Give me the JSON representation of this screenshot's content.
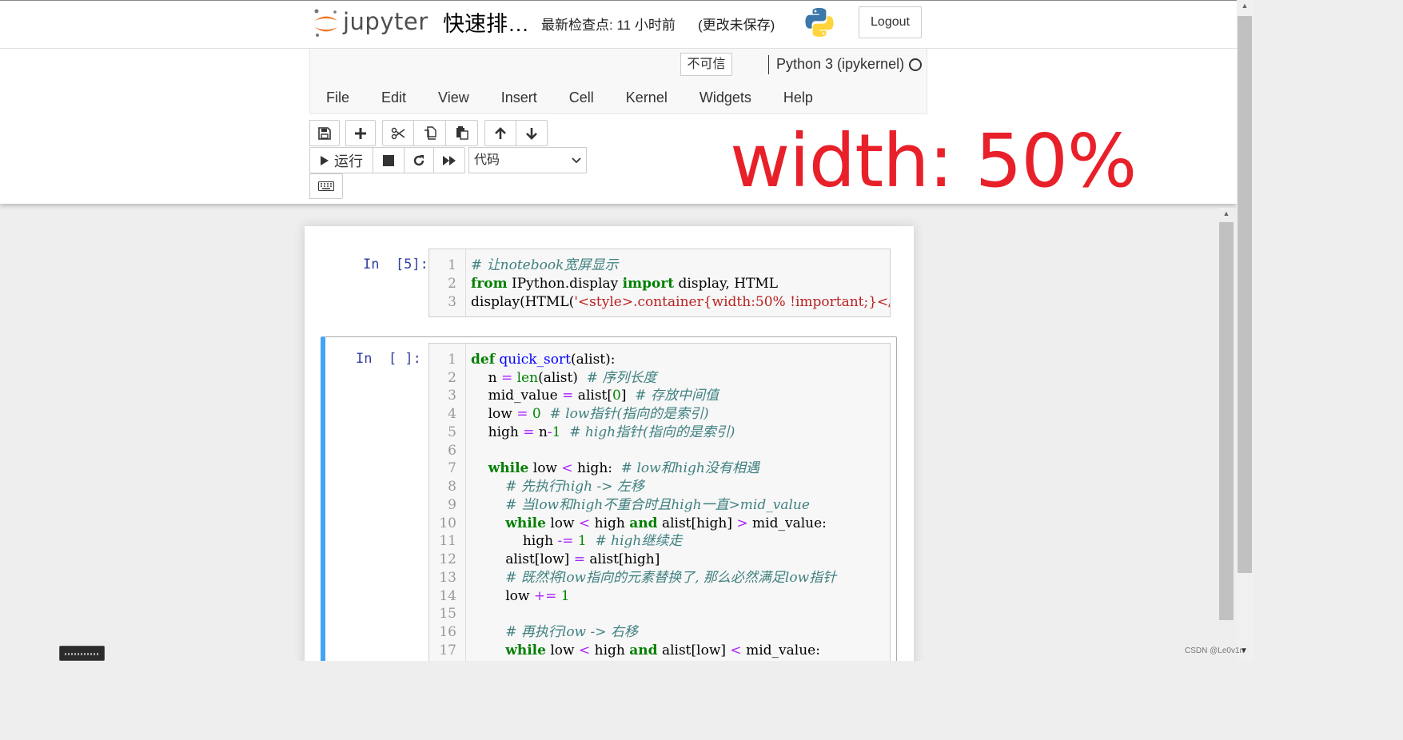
{
  "header": {
    "logo_text": "jupyter",
    "notebook_title": "快速排…",
    "checkpoint": "最新检查点: 11 小时前",
    "autosave_status": "(更改未保存)",
    "logout_label": "Logout",
    "trust_badge": "不可信",
    "kernel_name": "Python 3 (ipykernel)"
  },
  "menu": {
    "items": [
      "File",
      "Edit",
      "View",
      "Insert",
      "Cell",
      "Kernel",
      "Widgets",
      "Help"
    ]
  },
  "toolbar": {
    "run_label": "运行",
    "cell_type": "代码",
    "buttons": [
      "save-icon",
      "plus-icon",
      "scissors-icon",
      "copy-icon",
      "paste-icon",
      "arrow-up-icon",
      "arrow-down-icon",
      "play-icon",
      "stop-icon",
      "restart-icon",
      "fast-forward-icon",
      "keyboard-icon"
    ]
  },
  "annotation": "width: 50%",
  "cells": [
    {
      "prompt": "In  [5]:",
      "line_numbers": [
        "1",
        "2",
        "3"
      ]
    },
    {
      "prompt": "In  [ ]:",
      "line_numbers": [
        "1",
        "2",
        "3",
        "4",
        "5",
        "6",
        "7",
        "8",
        "9",
        "10",
        "11",
        "12",
        "13",
        "14",
        "15",
        "16",
        "17"
      ]
    }
  ],
  "code": {
    "c1": {
      "l1_comment": "# 让notebook宽屏显示",
      "l2_from": "from",
      "l2_mod": " IPython.display ",
      "l2_import": "import",
      "l2_rest": " display, HTML",
      "l3_pre": "display(HTML(",
      "l3_q": "'",
      "l3_tag": "<style>",
      "l3_str": ".container{width:50% !important;}</"
    },
    "c2": {
      "l1_def": "def",
      "l1_fn": " quick_sort",
      "l1_rest": "(alist):",
      "l2_a": "    n ",
      "l2_eq": "=",
      "l2_sp": " ",
      "l2_len": "len",
      "l2_b": "(alist)  ",
      "l2_cm": "# 序列长度",
      "l3_a": "    mid_value ",
      "l3_eq": "=",
      "l3_b": " alist[",
      "l3_n": "0",
      "l3_c": "]  ",
      "l3_cm": "# 存放中间值",
      "l4_a": "    low ",
      "l4_eq": "=",
      "l4_sp": " ",
      "l4_n": "0",
      "l4_sp2": "  ",
      "l4_cm": "# low指针(指向的是索引)",
      "l5_a": "    high ",
      "l5_eq": "=",
      "l5_b": " n",
      "l5_op": "-",
      "l5_n": "1",
      "l5_sp": "  ",
      "l5_cm": "# high指针(指向的是索引)",
      "l7_ind": "    ",
      "l7_while": "while",
      "l7_a": " low ",
      "l7_lt": "<",
      "l7_b": " high:  ",
      "l7_cm": "# low和high没有相遇",
      "l8_cm": "        # 先执行high -> 左移",
      "l9_cm": "        # 当low和high不重合时且high一直>mid_value",
      "l10_ind": "        ",
      "l10_while": "while",
      "l10_a": " low ",
      "l10_lt": "<",
      "l10_b": " high ",
      "l10_and": "and",
      "l10_c": " alist[high] ",
      "l10_gt": ">",
      "l10_d": " mid_value:",
      "l11_a": "            high ",
      "l11_op": "-=",
      "l11_sp": " ",
      "l11_n": "1",
      "l11_sp2": "  ",
      "l11_cm": "# high继续走",
      "l12_a": "        alist[low] ",
      "l12_eq": "=",
      "l12_b": " alist[high]",
      "l13_cm": "        # 既然将low指向的元素替换了, 那么必然满足low指针",
      "l14_a": "        low ",
      "l14_op": "+=",
      "l14_sp": " ",
      "l14_n": "1",
      "l16_cm": "        # 再执行low -> 右移",
      "l17_ind": "        ",
      "l17_while": "while",
      "l17_a": " low ",
      "l17_lt": "<",
      "l17_b": " high ",
      "l17_and": "and",
      "l17_c": " alist[low] ",
      "l17_lt2": "<",
      "l17_d": " mid_value:"
    }
  },
  "watermark": "CSDN @Le0v1n",
  "colors": {
    "annotation": "#e8202a",
    "keyword": "#008000",
    "comment": "#408080",
    "operator": "#aa22ff",
    "string": "#ba2121",
    "function": "#0000ff",
    "prompt": "#303f9f",
    "selected_cell_bar": "#42a5f5"
  }
}
